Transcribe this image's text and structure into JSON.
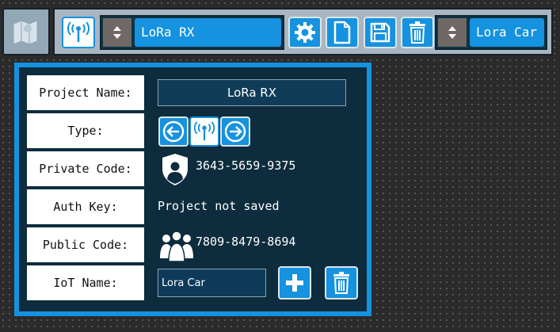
{
  "toolbar": {
    "project_selector": {
      "value": "LoRa RX"
    },
    "iot_selector": {
      "value": "Lora Car"
    },
    "buttons": [
      "settings-icon",
      "new-file-icon",
      "save-icon",
      "trash-icon"
    ]
  },
  "panel": {
    "project_name": {
      "label": "Project Name:",
      "value": "LoRa RX"
    },
    "type": {
      "label": "Type:",
      "icon": "lora-antenna-icon"
    },
    "private_code": {
      "label": "Private Code:",
      "value": "3643-5659-9375",
      "icon": "user-shield-icon"
    },
    "auth_key": {
      "label": "Auth Key:",
      "value": "Project not saved"
    },
    "public_code": {
      "label": "Public Code:",
      "value": "7809-8479-8694",
      "icon": "users-group-icon"
    },
    "iot_name": {
      "label": "IoT Name:",
      "value": "Lora Car"
    }
  },
  "colors": {
    "accent": "#1592e0",
    "panel_bg": "#0d2c3d",
    "toolbar_bg": "#a9b6c0",
    "field_bg": "#0d3a58"
  }
}
